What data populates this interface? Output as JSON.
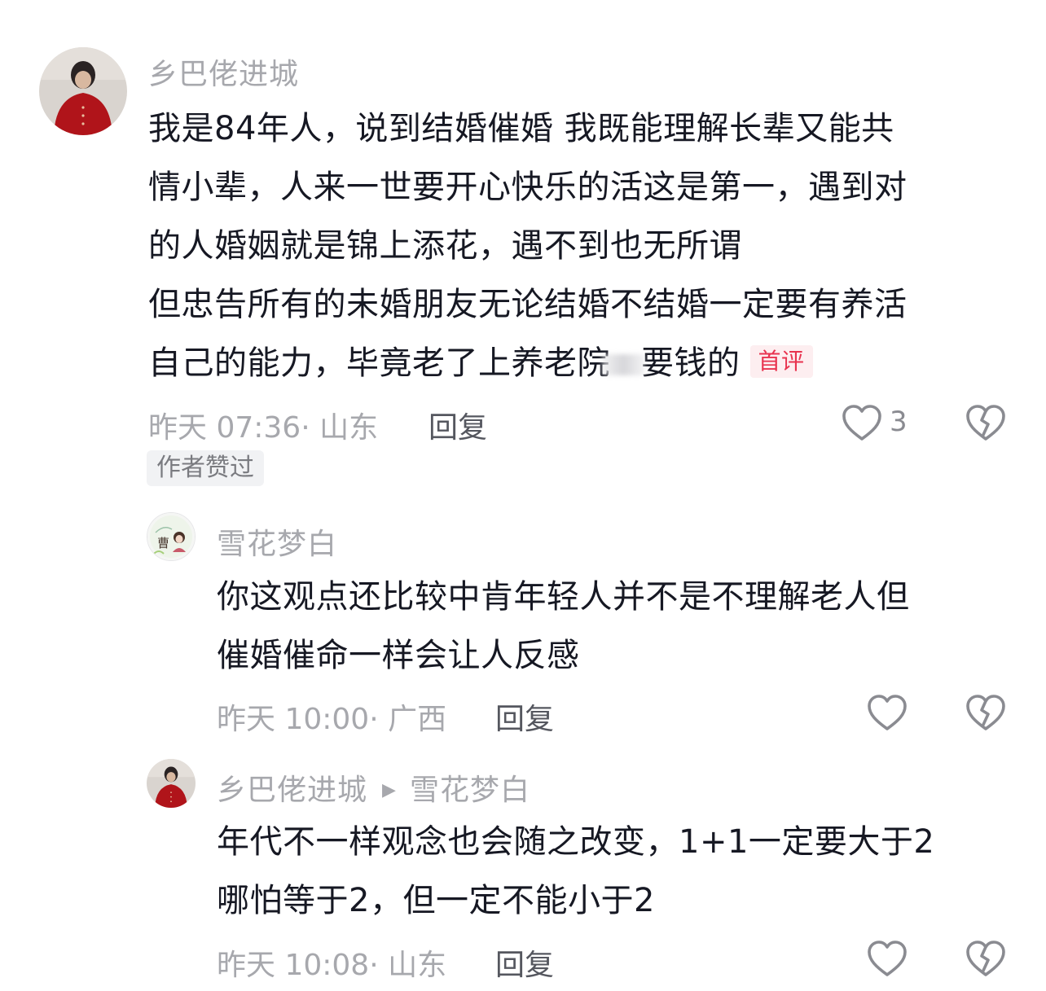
{
  "comments": [
    {
      "username": "乡巴佬进城",
      "lines": [
        "我是84年人，说到结婚催婚 我既能理解长辈又能共",
        "情小辈，人来一世要开心快乐的活这是第一，遇到对",
        "的人婚姻就是锦上添花，遇不到也无所谓",
        "但忠告所有的未婚朋友无论结婚不结婚一定要有养活"
      ],
      "last_line_a": "自己的能力，毕竟老了上养老院",
      "last_line_b": "要钱的",
      "tag": "首评",
      "meta": "昨天 07:36· 山东",
      "reply_label": "回复",
      "like_count": "3",
      "badge": "作者赞过"
    },
    {
      "username": "雪花梦白",
      "lines": [
        "你这观点还比较中肯年轻人并不是不理解老人但",
        "催婚催命一样会让人反感"
      ],
      "meta": "昨天 10:00· 广西",
      "reply_label": "回复"
    },
    {
      "username": "乡巴佬进城",
      "reply_to": "雪花梦白",
      "lines": [
        "年代不一样观念也会随之改变，1+1一定要大于2",
        "哪怕等于2，但一定不能小于2"
      ],
      "meta": "昨天 10:08· 山东",
      "reply_label": "回复"
    }
  ],
  "colors": {
    "tag_red": "#e8334f",
    "muted": "#a7a8ad",
    "text": "#161823"
  },
  "icons": [
    "heart-outline-icon",
    "broken-heart-icon"
  ]
}
